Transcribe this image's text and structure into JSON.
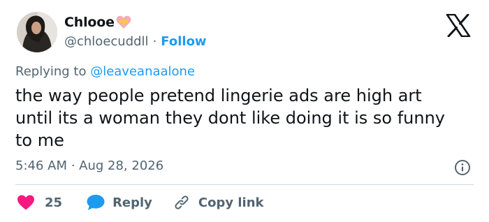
{
  "author": {
    "display_name": "Chlooe",
    "handle": "@chloecuddll",
    "separator": "·",
    "follow_label": "Follow"
  },
  "reply_context": {
    "prefix": "Replying to ",
    "mention": "@leaveanaalone"
  },
  "tweet": {
    "text": "the way people pretend lingerie ads are high art\nuntil its a woman they dont like doing it is so funny\nto me",
    "timestamp": "5:46 AM · Aug 28, 2026"
  },
  "actions": {
    "like_count": "25",
    "reply_label": "Reply",
    "copy_link_label": "Copy link"
  },
  "colors": {
    "accent": "#1d9bf0",
    "like": "#f91880",
    "secondary_text": "#536471",
    "primary_text": "#0f1419"
  },
  "icons": {
    "logo": "x-logo-icon",
    "badge": "heart-badge-icon",
    "info": "info-icon",
    "like": "heart-icon",
    "reply": "speech-bubble-icon",
    "copy": "link-icon"
  }
}
